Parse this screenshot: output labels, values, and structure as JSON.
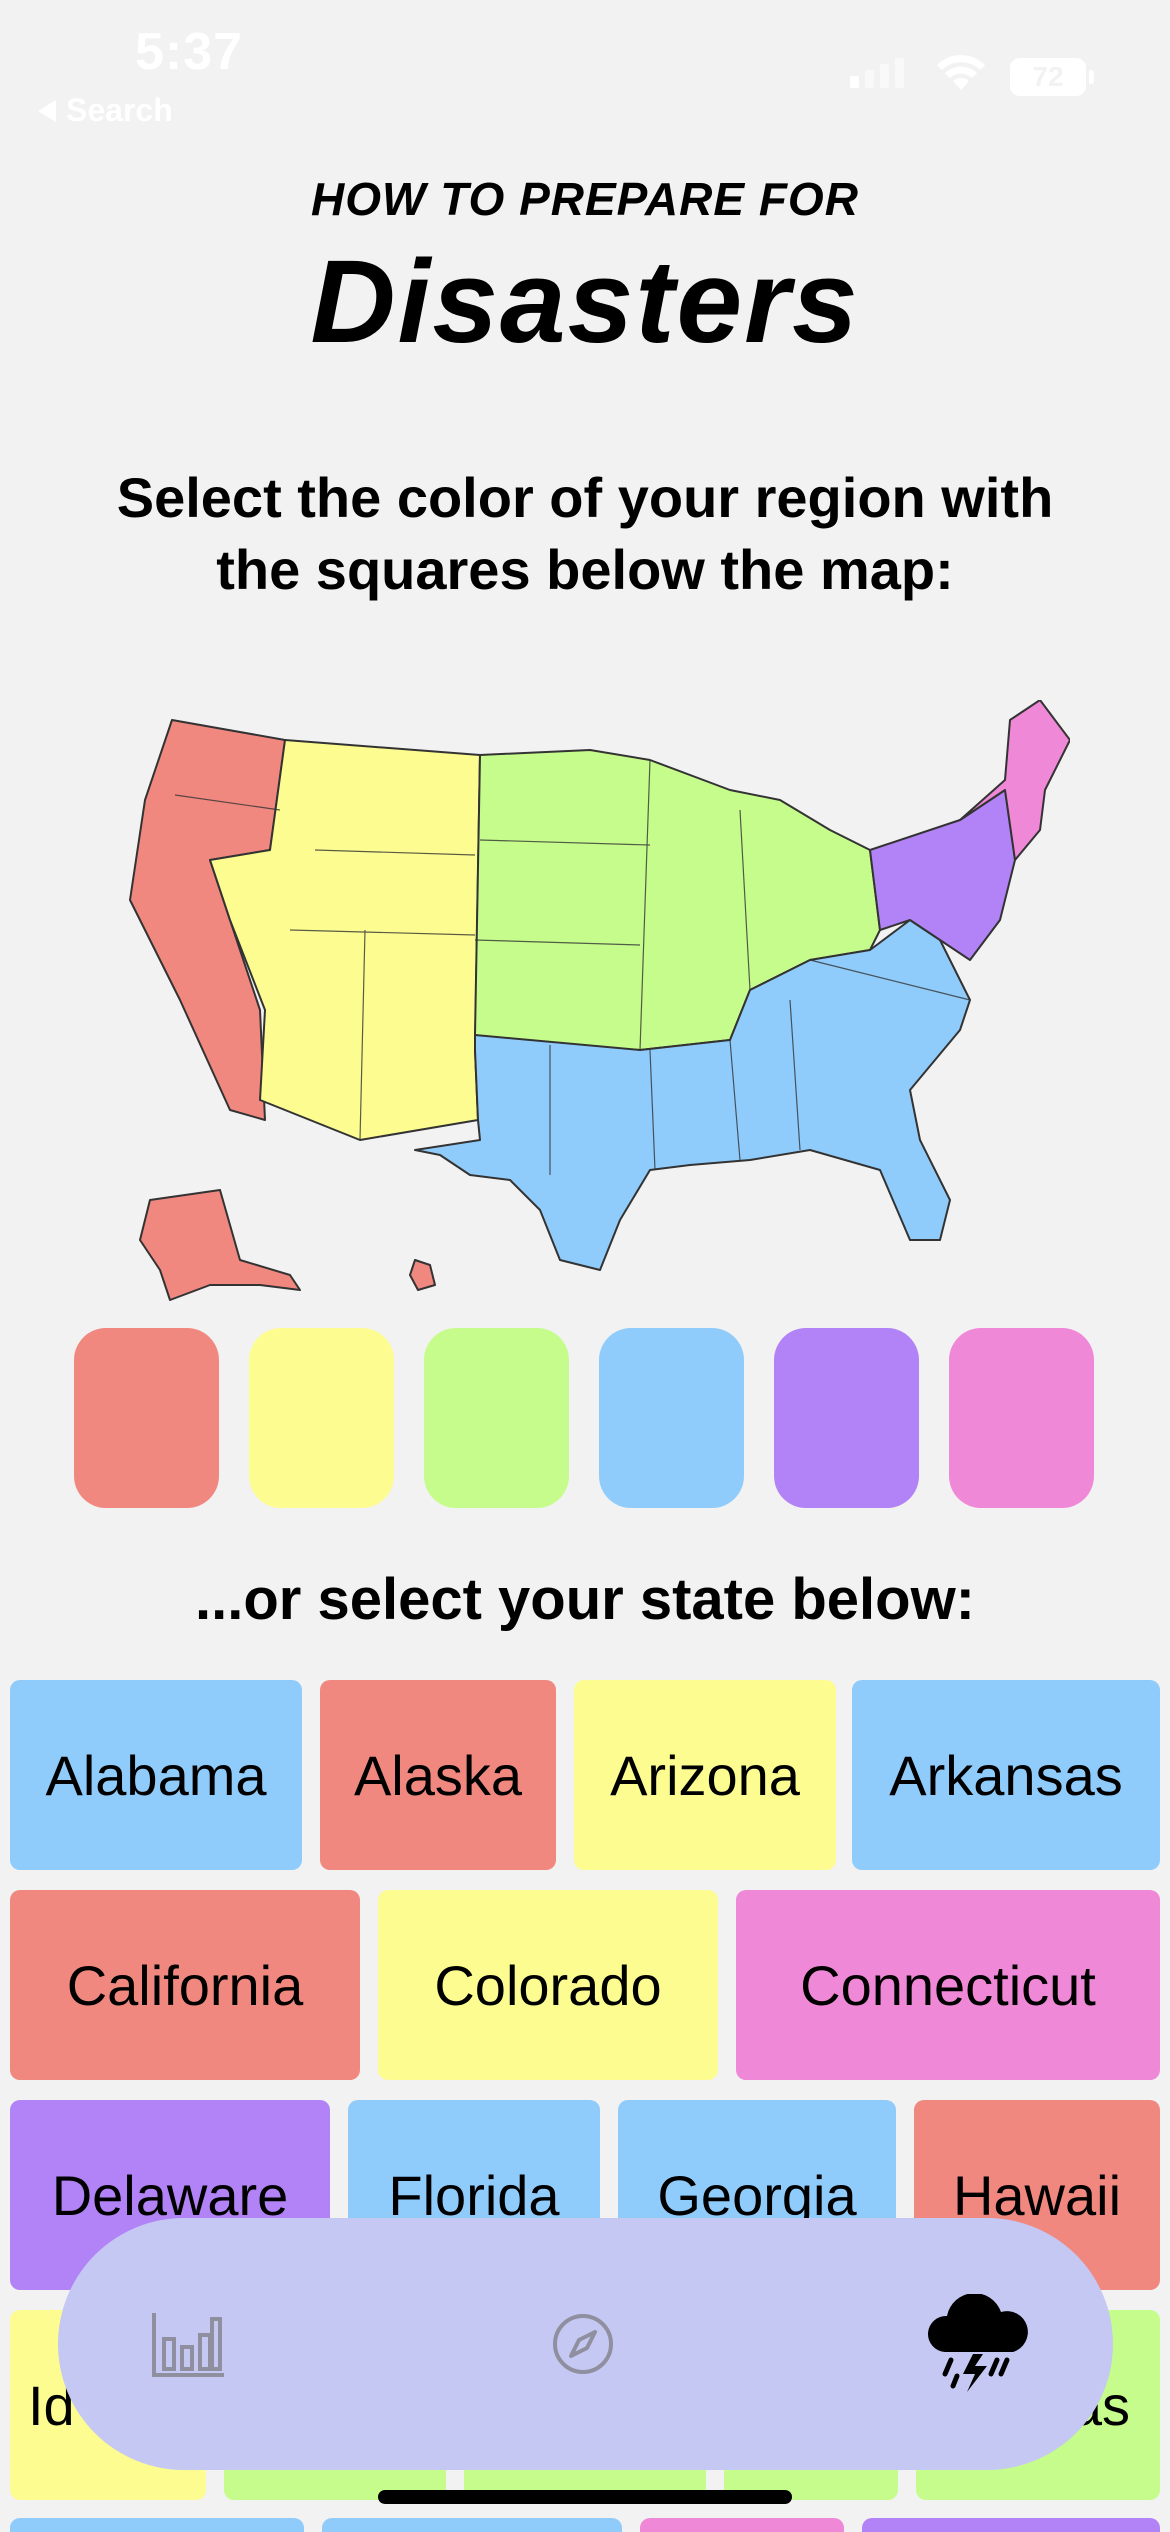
{
  "status_bar": {
    "time": "5:37",
    "back_label": "Search",
    "battery": "72"
  },
  "header": {
    "kicker": "HOW TO PREPARE FOR",
    "title": "Disasters"
  },
  "instructions": "Select the color of your region with the squares below the map:",
  "map": {
    "regions": [
      {
        "name": "west",
        "color": "#f08880"
      },
      {
        "name": "mountain",
        "color": "#fcfc90"
      },
      {
        "name": "midwest",
        "color": "#c6fc8c"
      },
      {
        "name": "south",
        "color": "#90ccfb"
      },
      {
        "name": "mid-atlantic",
        "color": "#b283f6"
      },
      {
        "name": "new-england",
        "color": "#f088d8"
      }
    ]
  },
  "region_squares": [
    {
      "color": "#f08880"
    },
    {
      "color": "#fcfc90"
    },
    {
      "color": "#c6fc8c"
    },
    {
      "color": "#90ccfb"
    },
    {
      "color": "#b283f6"
    },
    {
      "color": "#f088d8"
    }
  ],
  "or_select": "...or select your state below:",
  "states": [
    {
      "label": "Alabama",
      "color": "#90ccfb"
    },
    {
      "label": "Alaska",
      "color": "#f08880"
    },
    {
      "label": "Arizona",
      "color": "#fcfc90"
    },
    {
      "label": "Arkansas",
      "color": "#90ccfb"
    },
    {
      "label": "California",
      "color": "#f08880"
    },
    {
      "label": "Colorado",
      "color": "#fcfc90"
    },
    {
      "label": "Connecticut",
      "color": "#f088d8"
    },
    {
      "label": "Delaware",
      "color": "#b283f6"
    },
    {
      "label": "Florida",
      "color": "#90ccfb"
    },
    {
      "label": "Georgia",
      "color": "#90ccfb"
    },
    {
      "label": "Hawaii",
      "color": "#f08880"
    },
    {
      "label": "Id",
      "color": "#fcfc90"
    },
    {
      "label": "",
      "color": "#c6fc8c"
    },
    {
      "label": "",
      "color": "#c6fc8c"
    },
    {
      "label": "",
      "color": "#c6fc8c"
    },
    {
      "label": "as",
      "color": "#c6fc8c"
    }
  ],
  "tab_bar": {
    "tabs": [
      {
        "icon": "bar-chart-icon",
        "selected": false
      },
      {
        "icon": "compass-icon",
        "selected": false
      },
      {
        "icon": "storm-cloud-icon",
        "selected": true
      }
    ],
    "background": "#c5c8f3"
  }
}
